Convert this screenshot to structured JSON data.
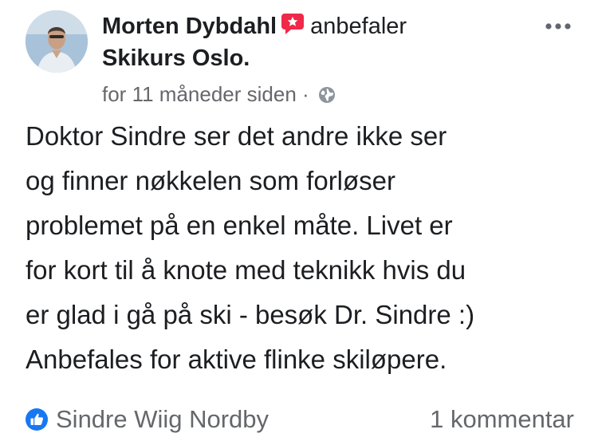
{
  "post": {
    "author": "Morten Dybdahl",
    "verb": "anbefaler",
    "target": "Skikurs Oslo.",
    "timestamp": "for 11 måneder siden",
    "separator": "·",
    "audience_icon": "globe-icon",
    "recommend_icon": "recommend-speech-bubble-icon",
    "more_icon": "more-options-icon",
    "body_lines": [
      "Doktor Sindre ser det andre ikke ser",
      "og finner nøkkelen som forløser",
      "problemet på en enkel måte. Livet er",
      "for kort til å knote med teknikk hvis du",
      "er glad i gå på ski - besøk Dr. Sindre :)",
      "Anbefales for aktive flinke skiløpere."
    ]
  },
  "footer": {
    "reaction_icon": "like-icon",
    "liker": "Sindre Wiig Nordby",
    "comments": "1 kommentar"
  },
  "colors": {
    "text": "#1c1e21",
    "secondary": "#65676b",
    "like_blue": "#1877f2",
    "recommend_red": "#f02849"
  }
}
